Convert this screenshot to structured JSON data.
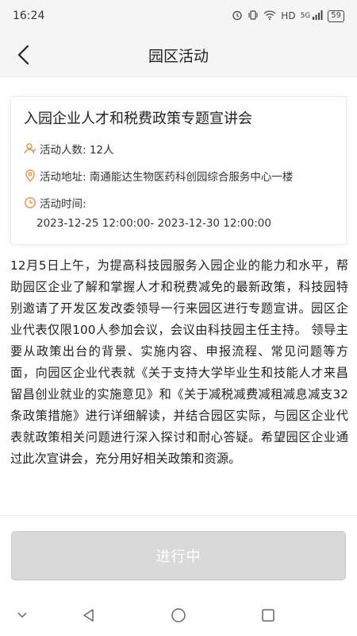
{
  "status_bar": {
    "time": "16:24",
    "network": "HD",
    "signal": "5G",
    "battery": "59",
    "icons": [
      "alarm-icon",
      "vibrate-icon",
      "wifi-icon",
      "signal-icon",
      "battery-icon"
    ]
  },
  "header": {
    "title": "园区活动",
    "back_icon": "chevron-left-icon"
  },
  "event": {
    "title": "入园企业人才和税费政策专题宣讲会",
    "people": "活动人数: 12人",
    "address": "活动地址: 南通能达生物医药科创园综合服务中心一楼",
    "time_label": "活动时间:",
    "time_value": "2023-12-25 12:00:00- 2023-12-30 12:00:00"
  },
  "description": "12月5日上午，为提高科技园服务入园企业的能力和水平，帮助园区企业了解和掌握人才和税费减免的最新政策，科技园特别邀请了开发区发改委领导一行来园区进行专题宣讲。园区企业代表仅限100人参加会议，会议由科技园主任主持。 领导主要从政策出台的背景、实施内容、申报流程、常见问题等方面，向园区企业代表就《关于支持大学毕业生和技能人才来昌留昌创业就业的实施意见》和《关于减税减费减租减息减支32条政策措施》进行详细解读，并结合园区实际，与园区企业代表就政策相关问题进行深入探讨和耐心答疑。希望园区企业通过此次宣讲会，充分用好相关政策和资源。",
  "action": {
    "status_label": "进行中"
  },
  "colors": {
    "accent_orange": "#e8883a",
    "button_bg": "#d9d9d9",
    "header_bg": "#f5f5f5"
  }
}
